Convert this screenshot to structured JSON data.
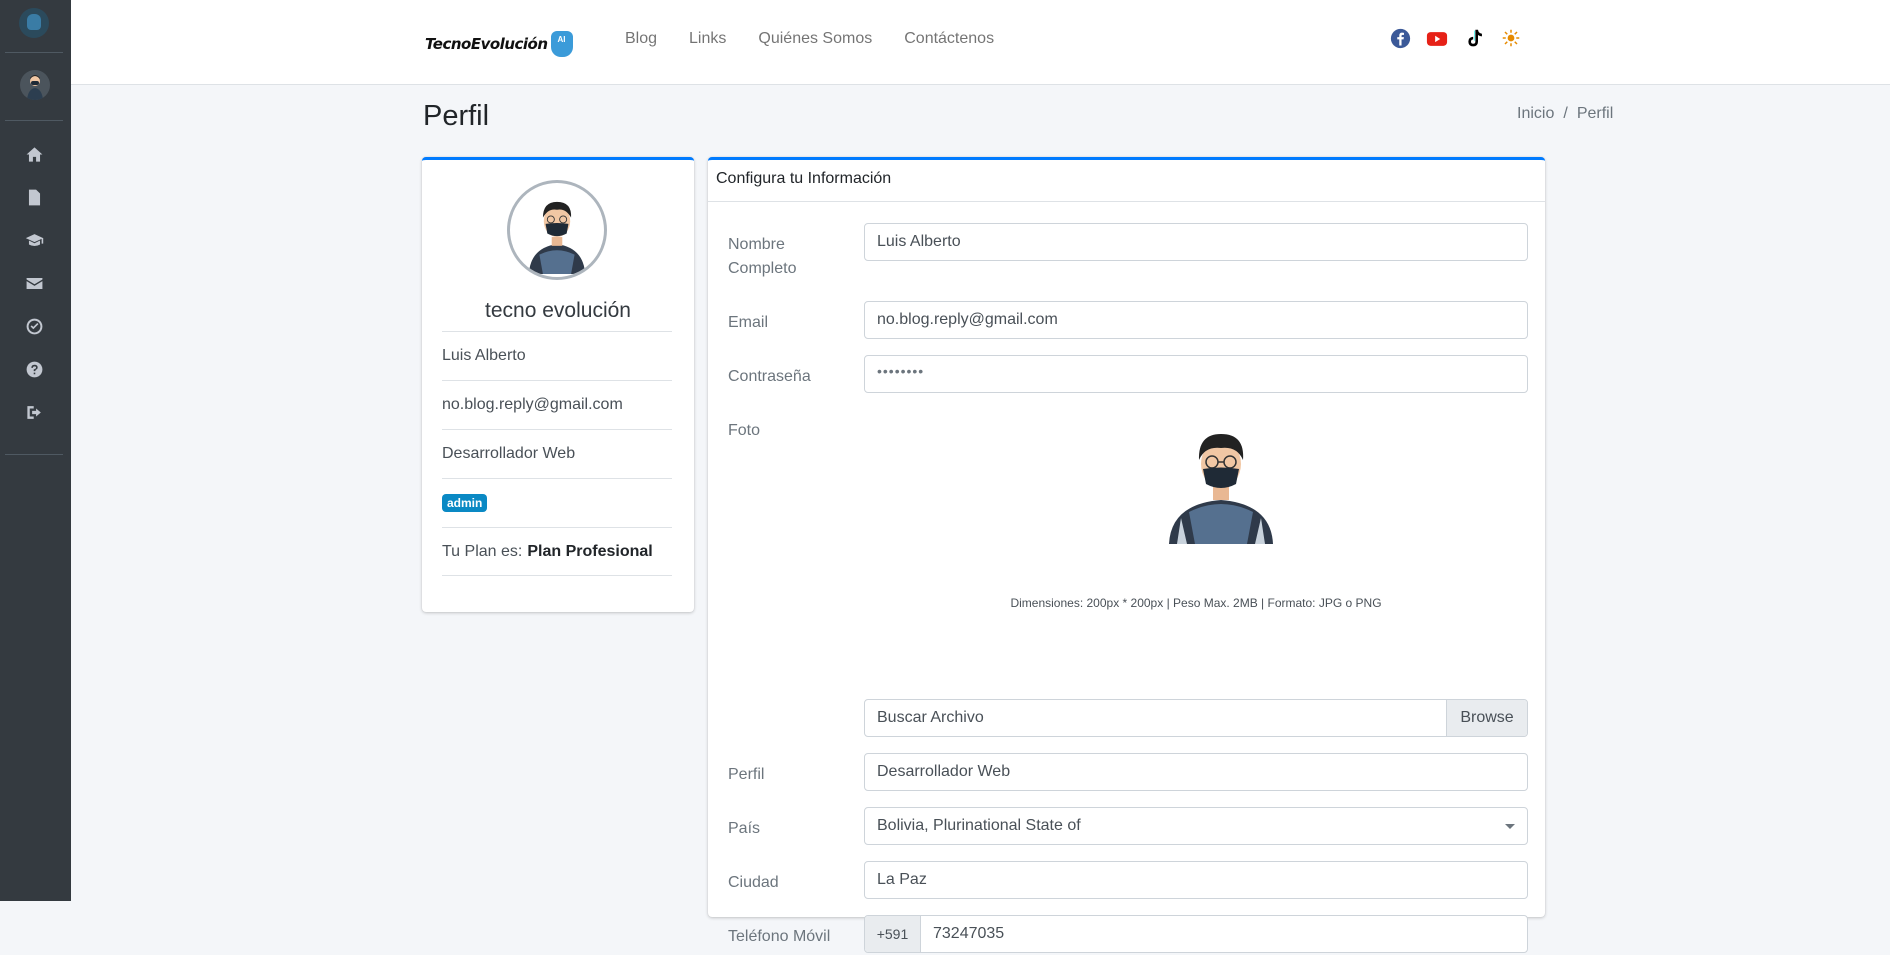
{
  "nav": {
    "brand": "TecnoEvolución",
    "brand_badge": "AI",
    "links": [
      "Blog",
      "Links",
      "Quiénes Somos",
      "Contáctenos"
    ]
  },
  "sidebar": {
    "icons": [
      "home-icon",
      "file-icon",
      "graduation-cap-icon",
      "envelope-icon",
      "check-circle-icon",
      "question-circle-icon",
      "sign-out-icon"
    ]
  },
  "social": {
    "icons": [
      "facebook-icon",
      "youtube-icon",
      "tiktok-icon",
      "sun-icon"
    ],
    "colors": {
      "facebook": "#3b5998",
      "youtube": "#e62117",
      "tiktok": "#000000",
      "sun": "#e68a00"
    }
  },
  "page": {
    "title": "Perfil",
    "breadcrumb": {
      "home": "Inicio",
      "separator": "/",
      "current": "Perfil"
    }
  },
  "profile": {
    "name": "tecno evolución",
    "full_name": "Luis Alberto",
    "email": "no.blog.reply@gmail.com",
    "role": "Desarrollador Web",
    "badge": "admin",
    "plan_label": "Tu Plan es:",
    "plan_name": "Plan Profesional"
  },
  "form": {
    "header": "Configura tu Información",
    "name_label": "Nombre Completo",
    "name_value": "Luis Alberto",
    "email_label": "Email",
    "email_value": "no.blog.reply@gmail.com",
    "password_label": "Contraseña",
    "password_value": "••••••••",
    "photo_label": "Foto",
    "photo_hint": "Dimensiones: 200px * 200px | Peso Max. 2MB | Formato: JPG o PNG",
    "file_placeholder": "Buscar Archivo",
    "browse_label": "Browse",
    "profile_label": "Perfil",
    "profile_value": "Desarrollador Web",
    "country_label": "País",
    "country_value": "Bolivia, Plurinational State of",
    "city_label": "Ciudad",
    "city_value": "La Paz",
    "phone_label": "Teléfono Móvil",
    "phone_prefix": "+591",
    "phone_value": "73247035"
  },
  "colors": {
    "primary": "#007bff",
    "sidebar": "#343a40",
    "badge": "#0a89c4"
  }
}
